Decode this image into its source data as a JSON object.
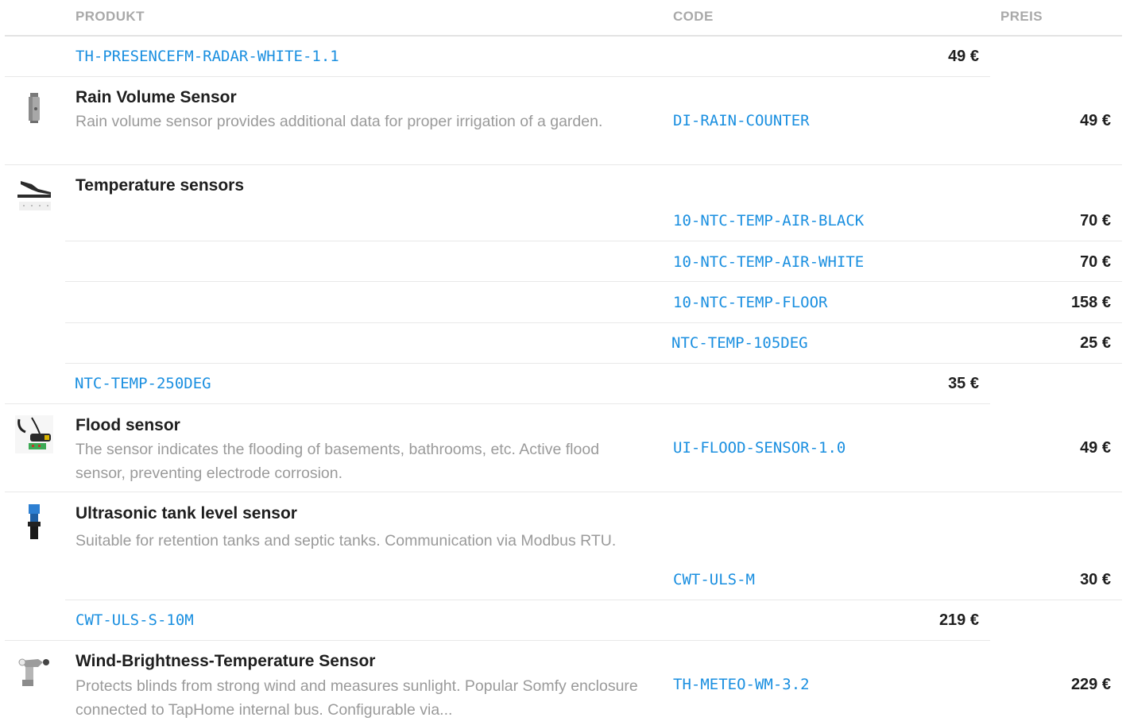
{
  "columns": {
    "product": "PRODUKT",
    "code": "CODE",
    "price": "PREIS"
  },
  "rows": {
    "presence": {
      "code": "TH-PRESENCEFM-RADAR-WHITE-1.1",
      "price": "49 €"
    },
    "rain": {
      "name": "Rain Volume Sensor",
      "desc": "Rain volume sensor provides additional data for proper irrigation of a garden.",
      "code": "DI-RAIN-COUNTER",
      "price": "49 €",
      "icon": "rain-sensor-icon"
    },
    "temperature": {
      "name": "Temperature sensors",
      "icon": "temperature-sensor-icon",
      "variants": [
        {
          "code": "10-NTC-TEMP-AIR-BLACK",
          "price": "70 €"
        },
        {
          "code": "10-NTC-TEMP-AIR-WHITE",
          "price": "70 €"
        },
        {
          "code": "10-NTC-TEMP-FLOOR",
          "price": "158 €"
        },
        {
          "code": "NTC-TEMP-105DEG",
          "price": "25 €"
        },
        {
          "code": "NTC-TEMP-250DEG",
          "price": "35 €"
        }
      ]
    },
    "flood": {
      "name": "Flood sensor",
      "desc": "The sensor indicates the flooding of basements, bathrooms, etc. Active flood sensor, preventing electrode corrosion.",
      "code": "UI-FLOOD-SENSOR-1.0",
      "price": "49 €",
      "icon": "flood-sensor-icon"
    },
    "tank": {
      "name": "Ultrasonic tank level sensor",
      "desc": "Suitable for retention tanks and septic tanks. Communication via Modbus RTU.",
      "icon": "ultrasonic-sensor-icon",
      "variants": [
        {
          "code": "CWT-ULS-M",
          "price": "30 €"
        },
        {
          "code": "CWT-ULS-S-10M",
          "price": "219 €"
        }
      ]
    },
    "meteo": {
      "name": "Wind-Brightness-Temperature Sensor",
      "desc": "Protects blinds from strong wind and measures sunlight. Popular Somfy enclosure connected to TapHome internal bus. Configurable via...",
      "code": "TH-METEO-WM-3.2",
      "price": "229 €",
      "icon": "meteo-sensor-icon"
    }
  },
  "colors": {
    "link": "#1a8fe0",
    "header": "#a9a9a9",
    "text": "#1e1e1e",
    "muted": "#9a9a9a",
    "divider": "#e8e8e8"
  }
}
